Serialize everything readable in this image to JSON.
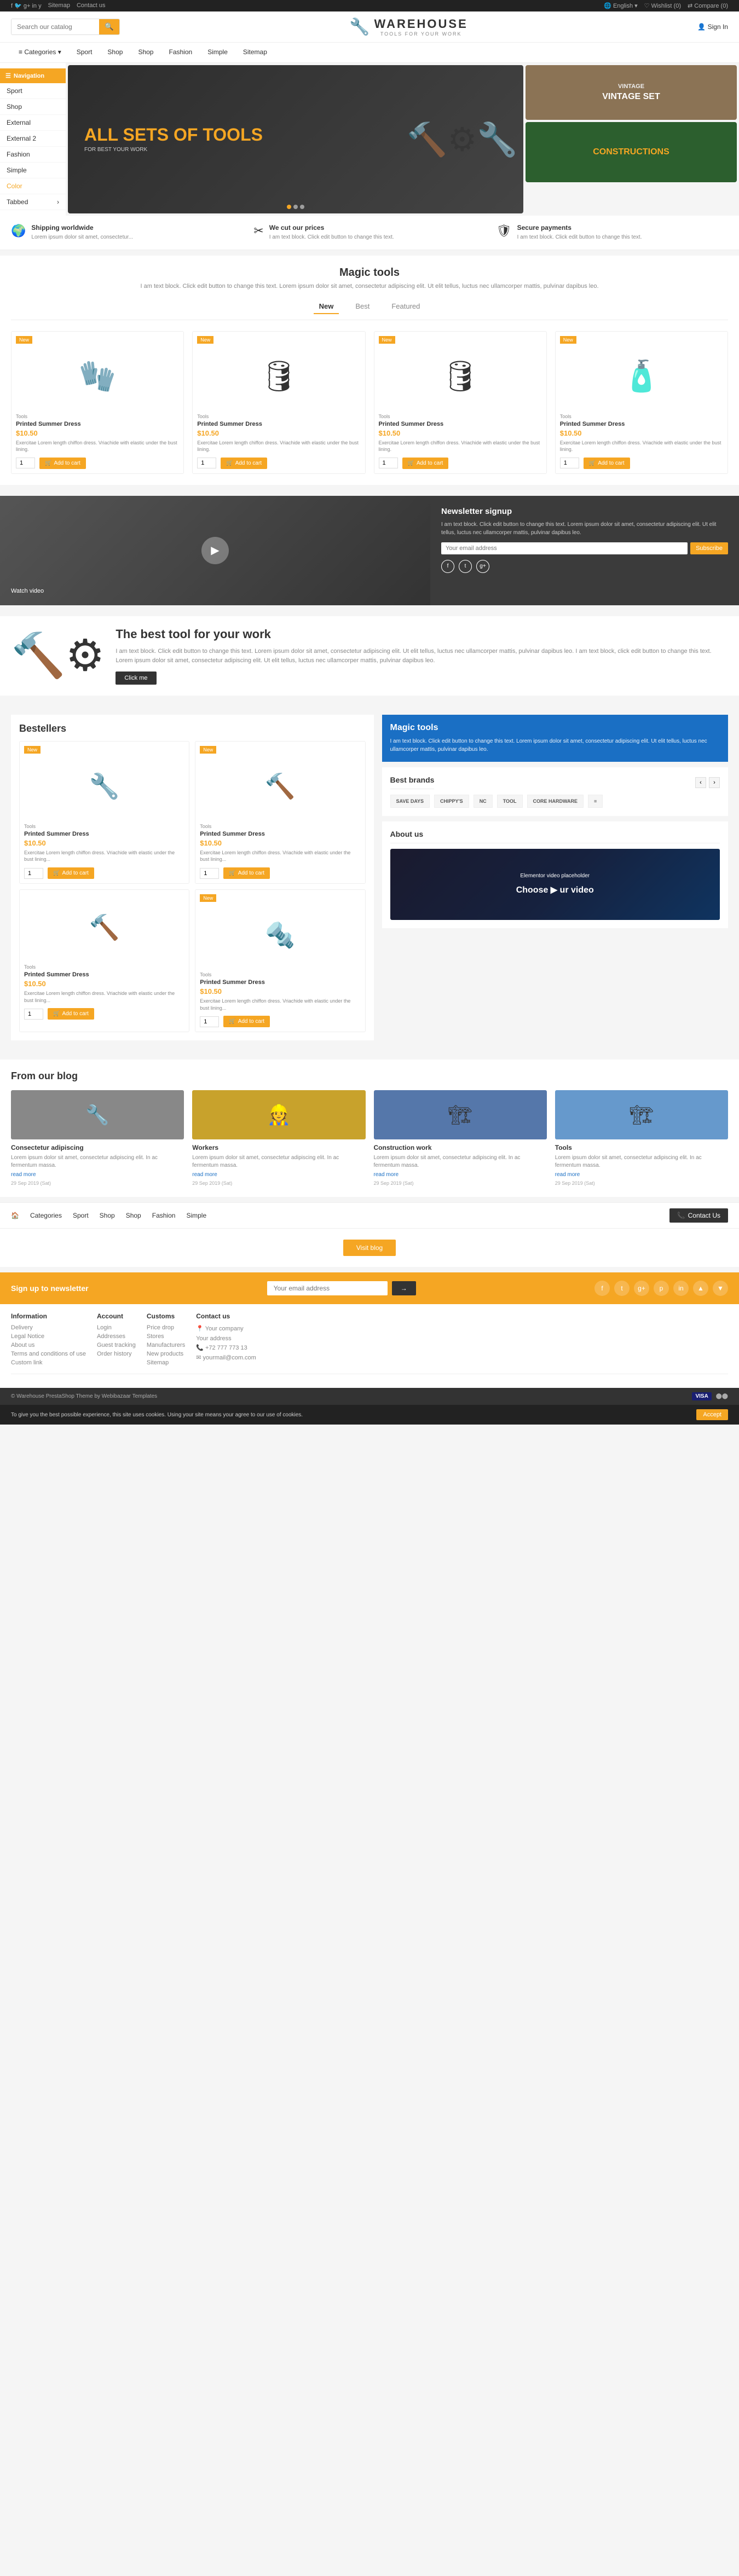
{
  "topbar": {
    "social_icons": [
      "f",
      "t",
      "g",
      "in",
      "y"
    ],
    "links": [
      "Sitemap",
      "Contact us"
    ],
    "right_items": [
      "English",
      "Wishlist (0)",
      "Compare (0)"
    ]
  },
  "header": {
    "search_placeholder": "Search our catalog",
    "logo_icon": "🔧",
    "logo_title": "WAREHOUSE",
    "logo_subtitle": "TOOLS FOR YOUR WORK",
    "signin": "Sign In"
  },
  "navigation": {
    "items": [
      "Category",
      "Sport",
      "Shop",
      "Shop",
      "Fashion",
      "Simple",
      "Sitemap"
    ]
  },
  "sidebar": {
    "title": "Navigation",
    "items": [
      {
        "label": "Sport",
        "has_arrow": false
      },
      {
        "label": "Shop",
        "has_arrow": false
      },
      {
        "label": "External",
        "has_arrow": false
      },
      {
        "label": "External 2",
        "has_arrow": false
      },
      {
        "label": "Fashion",
        "has_arrow": false
      },
      {
        "label": "Simple",
        "has_arrow": false
      },
      {
        "label": "Color",
        "has_arrow": false,
        "is_color": true
      },
      {
        "label": "Tabbed",
        "has_arrow": true
      }
    ]
  },
  "hero": {
    "main_text": "ALL SETS OF TOOLS",
    "sub_text": "FOR BEST YOUR WORK",
    "side_top_text": "VINTAGE SET",
    "side_bottom_text": "CONSTRUCTIONS"
  },
  "info_strip": {
    "items": [
      {
        "icon": "🌍",
        "title": "Shipping worldwide",
        "text": "Lorem ipsum dolor sit amet, consectetur..."
      },
      {
        "icon": "✂",
        "title": "We cut our prices",
        "text": "I am text block. Click edit button to change this text."
      },
      {
        "icon": "🛡",
        "title": "Secure payments",
        "text": "I am text block. Click edit button to change this text."
      }
    ]
  },
  "magic_tools": {
    "title": "Magic tools",
    "sub": "I am text block. Click edit button to change this text.\nLorem ipsum dolor sit amet, consectetur adipiscing elit. Ut elit tellus, luctus nec ullamcorper mattis, pulvinar dapibus leo.",
    "tabs": [
      "New",
      "Best",
      "Featured"
    ],
    "active_tab": "New",
    "products": [
      {
        "badge": "New",
        "emoji": "🧤",
        "category": "Tools",
        "name": "Printed Summer Dress",
        "price": "$10.50",
        "desc": "Exercitae Lorem length chiffon dress. Vriachide with elastic under the bust lining.",
        "qty": "1"
      },
      {
        "badge": "New",
        "emoji": "🛢",
        "category": "Tools",
        "name": "Printed Summer Dress",
        "price": "$10.50",
        "desc": "Exercitae Lorem length chiffon dress. Vriachide with elastic under the bust lining.",
        "qty": "1"
      },
      {
        "badge": "New",
        "emoji": "🛢",
        "category": "Tools",
        "name": "Printed Summer Dress",
        "price": "$10.50",
        "desc": "Exercitae Lorem length chiffon dress. Vriachide with elastic under the bust lining.",
        "qty": "1"
      },
      {
        "badge": "New",
        "emoji": "🧴",
        "category": "Tools",
        "name": "Printed Summer Dress",
        "price": "$10.50",
        "desc": "Exercitae Lorem length chiffon dress. Vriachide with elastic under the bust lining.",
        "qty": "1"
      }
    ]
  },
  "video_section": {
    "label": "Watch video",
    "newsletter_title": "Newsletter signup",
    "newsletter_desc": "I am text block. Click edit button to change this text. Lorem ipsum dolor sit amet, consectetur adipiscing elit. Ut elit tellus, luctus nec ullamcorper mattis, pulvinar dapibus leo.",
    "email_placeholder": "Your email address",
    "subscribe_label": "Subscribe",
    "social": [
      "f",
      "t",
      "g+"
    ]
  },
  "best_tool": {
    "title": "The best tool for your work",
    "desc": "I am text block. Click edit button to change this text. Lorem ipsum dolor sit amet, consectetur adipiscing elit. Ut elit tellus, luctus nec ullamcorper mattis, pulvinar dapibus leo. I am text block, click edit button to change this text. Lorem ipsum dolor sit amet, consectetur adipiscing elit. Ut elit tellus, luctus nec ullamcorper mattis, pulvinar dapibus leo.",
    "cta": "Click me"
  },
  "bestellers": {
    "title": "Bestellers",
    "products": [
      {
        "badge": "New",
        "emoji": "🔧",
        "category": "Tools",
        "name": "Printed Summer Dress",
        "price": "$10.50",
        "desc": "Exercitae Lorem length chiffon dress. Vriachide with elastic under the bust lining...",
        "qty": "1"
      },
      {
        "badge": "New",
        "emoji": "🔨",
        "category": "Tools",
        "name": "Printed Summer Dress",
        "price": "$10.50",
        "desc": "Exercitae Lorem length chiffon dress. Vriachide with elastic under the bust lining...",
        "qty": "1"
      },
      {
        "badge": "",
        "emoji": "🔨",
        "category": "Tools",
        "name": "Printed Summer Dress",
        "price": "$10.50",
        "desc": "Exercitae Lorem length chiffon dress. Vriachide with elastic under the bust lining...",
        "qty": "1"
      },
      {
        "badge": "New",
        "emoji": "🔩",
        "category": "Tools",
        "name": "Printed Summer Dress",
        "price": "$10.50",
        "desc": "Exercitae Lorem length chiffon dress. Vriachide with elastic under the bust lining...",
        "qty": "1"
      }
    ]
  },
  "right_column": {
    "magic_tools": {
      "title": "Magic tools",
      "desc": "I am text block. Click edit button to change this text. Lorem ipsum dolor sit amet, consectetur adipiscing elit. Ut elit tellus, luctus nec ullamcorper mattis, pulvinar dapibus leo."
    },
    "best_brands": {
      "title": "Best brands",
      "brands": [
        "SAVE DAYS",
        "CHIPPY'S",
        "NC",
        "TOOL",
        "CORE HARDWARE",
        "≡"
      ]
    },
    "about_us": {
      "title": "About us",
      "video_label": "Elementor video placeholder",
      "video_cta": "Choose ▶ ur video"
    }
  },
  "blog": {
    "title": "From our blog",
    "posts": [
      {
        "title": "Consectetur adipiscing",
        "desc": "Lorem ipsum dolor sit amet, consectetur adipiscing elit. In ac fermentum massa.",
        "read_more": "read more",
        "date": "29 Sep 2019 (Sat)",
        "emoji": "🔧"
      },
      {
        "title": "Workers",
        "desc": "Lorem ipsum dolor sit amet, consectetur adipiscing elit. In ac fermentum massa.",
        "read_more": "read more",
        "date": "29 Sep 2019 (Sat)",
        "emoji": "👷"
      },
      {
        "title": "Construction work",
        "desc": "Lorem ipsum dolor sit amet, consectetur adipiscing elit. In ac fermentum massa.",
        "read_more": "read more",
        "date": "29 Sep 2019 (Sat)",
        "emoji": "🏗"
      },
      {
        "title": "Tools",
        "desc": "Lorem ipsum dolor sit amet, consectetur adipiscing elit. In ac fermentum massa.",
        "read_more": "read more",
        "date": "29 Sep 2019 (Sat)",
        "emoji": "🏗"
      }
    ],
    "visit_blog": "Visit blog"
  },
  "bottom_nav": {
    "items": [
      {
        "icon": "🏠",
        "label": ""
      },
      {
        "icon": "",
        "label": "Categories"
      },
      {
        "icon": "",
        "label": "Sport"
      },
      {
        "icon": "",
        "label": "Shop"
      },
      {
        "icon": "",
        "label": "Shop"
      },
      {
        "icon": "",
        "label": "Fashion"
      },
      {
        "icon": "",
        "label": "Simple"
      }
    ],
    "contact": "Contact Us"
  },
  "newsletter_bottom": {
    "text": "Sign up to newsletter",
    "placeholder": "Your email address",
    "button": "→",
    "social_icons": [
      "f",
      "t",
      "g+",
      "p",
      "in",
      "△",
      "▼"
    ]
  },
  "footer": {
    "sections": [
      {
        "title": "Information",
        "links": [
          "Delivery",
          "Legal Notice",
          "About us",
          "Terms and conditions of use",
          "Custom link"
        ]
      },
      {
        "title": "Account",
        "links": [
          "Login",
          "Addresses",
          "Guest tracking",
          "Order history"
        ]
      },
      {
        "title": "Customs",
        "links": [
          "Price drop",
          "Stores",
          "Manufacturers",
          "New products",
          "Sitemap"
        ]
      },
      {
        "title": "Contact us",
        "info": [
          "Your company",
          "Your address",
          "+72 777 773 13",
          "yourmail@com.com"
        ]
      }
    ],
    "cookie_text": "To give you the best possible experience, this site uses cookies. Using your site means your agree to our use of cookies.",
    "cookie_accept": "Accept",
    "bottom_text": "Visa MasterCard",
    "payment_icons": [
      "VISA",
      "MC"
    ]
  },
  "add_to_cart_label": "Add to cart",
  "colors": {
    "accent": "#f5a623",
    "dark": "#333333",
    "blue": "#1a6fc4"
  }
}
